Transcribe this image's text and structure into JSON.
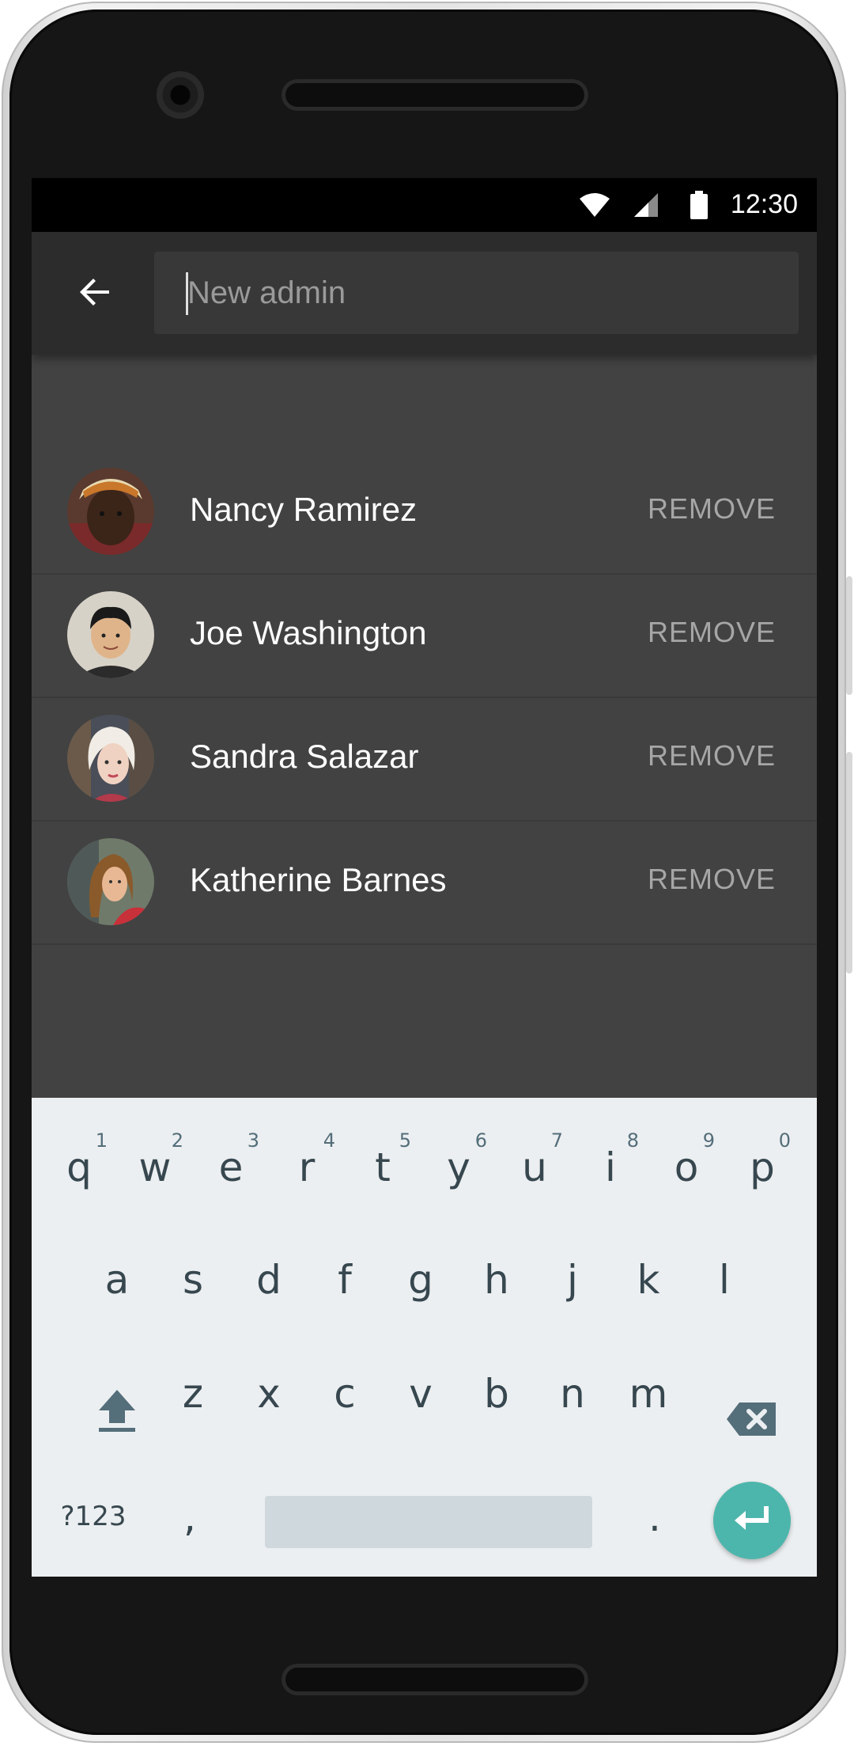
{
  "status_bar": {
    "time": "12:30"
  },
  "app_bar": {
    "back_icon": "arrow-back-icon",
    "search_placeholder": "New admin",
    "search_value": ""
  },
  "admins": [
    {
      "name": "Nancy Ramirez",
      "action": "REMOVE"
    },
    {
      "name": "Joe Washington",
      "action": "REMOVE"
    },
    {
      "name": "Sandra Salazar",
      "action": "REMOVE"
    },
    {
      "name": "Katherine Barnes",
      "action": "REMOVE"
    }
  ],
  "keyboard": {
    "row1": [
      {
        "key": "q",
        "hint": "1"
      },
      {
        "key": "w",
        "hint": "2"
      },
      {
        "key": "e",
        "hint": "3"
      },
      {
        "key": "r",
        "hint": "4"
      },
      {
        "key": "t",
        "hint": "5"
      },
      {
        "key": "y",
        "hint": "6"
      },
      {
        "key": "u",
        "hint": "7"
      },
      {
        "key": "i",
        "hint": "8"
      },
      {
        "key": "o",
        "hint": "9"
      },
      {
        "key": "p",
        "hint": "0"
      }
    ],
    "row2": [
      "a",
      "s",
      "d",
      "f",
      "g",
      "h",
      "j",
      "k",
      "l"
    ],
    "row3": [
      "z",
      "x",
      "c",
      "v",
      "b",
      "n",
      "m"
    ],
    "shift_icon": "shift-icon",
    "backspace_icon": "backspace-icon",
    "symbols_label": "?123",
    "comma": ",",
    "period": ".",
    "enter_icon": "enter-icon"
  },
  "colors": {
    "screen_bg": "#424242",
    "app_bar_bg": "#2c2c2c",
    "keyboard_bg": "#eceff1",
    "key_text": "#37474f",
    "enter_accent": "#4db6ac",
    "remove_text": "#a6a6a6"
  }
}
